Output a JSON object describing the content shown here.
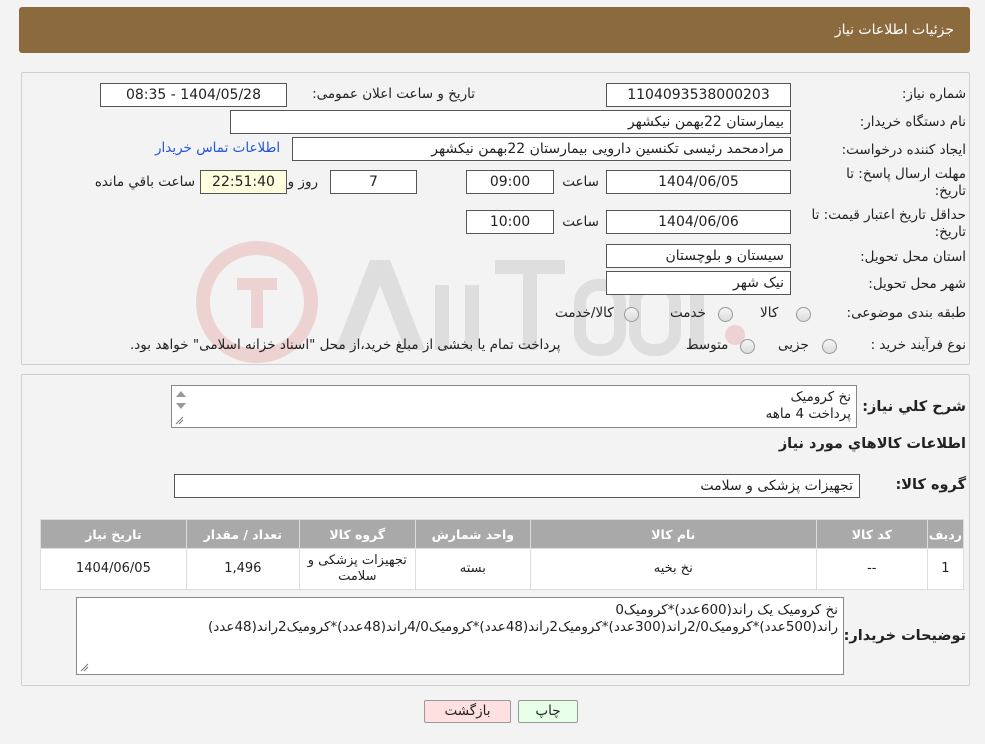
{
  "header": {
    "title": "جزئیات اطلاعات نیاز"
  },
  "form": {
    "need_number_label": "شماره نیاز:",
    "need_number": "1104093538000203",
    "announce_label": "تاریخ و ساعت اعلان عمومی:",
    "announce_value": "1404/05/28 - 08:35",
    "buyer_org_label": "نام دستگاه خریدار:",
    "buyer_org": "بیمارستان 22بهمن نیکشهر",
    "creator_label": "ایجاد کننده درخواست:",
    "creator": "مرادمحمد رئیسی تکنسین دارویی بیمارستان 22بهمن نیکشهر",
    "contact_link": "اطلاعات تماس خریدار",
    "deadline_label": "مهلت ارسال پاسخ: تا",
    "deadline_label2": "تاریخ:",
    "deadline_date": "1404/06/05",
    "time_label": "ساعت",
    "deadline_time": "09:00",
    "days_value": "7",
    "days_label": "روز و",
    "remaining_time": "22:51:40",
    "remaining_label": "ساعت باقي مانده",
    "validity_label": "حداقل تاریخ اعتبار قیمت: تا",
    "validity_label2": "تاریخ:",
    "validity_date": "1404/06/06",
    "validity_time": "10:00",
    "province_label": "استان محل تحویل:",
    "province": "سیستان و بلوچستان",
    "city_label": "شهر محل تحویل:",
    "city": "نیک شهر",
    "category_label": "طبقه بندی موضوعی:",
    "category_options": [
      "کالا",
      "خدمت",
      "کالا/خدمت"
    ],
    "process_label": "نوع فرآیند خرید :",
    "process_options": [
      "جزیی",
      "متوسط"
    ],
    "process_note": "پرداخت تمام یا بخشی از مبلغ خرید،از محل \"اسناد خزانه اسلامی\" خواهد بود."
  },
  "details": {
    "summary_label": "شرح کلي نياز:",
    "summary_line1": "نخ کرومیک",
    "summary_line2": "پرداخت 4 ماهه",
    "goods_info_title": "اطلاعات کالاهاي مورد نياز",
    "goods_group_label": "گروه کالا:",
    "goods_group": "تجهیزات پزشکی و سلامت",
    "table": {
      "headers": [
        "رديف",
        "کد کالا",
        "نام کالا",
        "واحد شمارش",
        "گروه کالا",
        "تعداد / مقدار",
        "تاريخ نياز"
      ],
      "rows": [
        [
          "1",
          "--",
          "نخ بخیه",
          "بسته",
          "تجهیزات پزشکی و سلامت",
          "1,496",
          "1404/06/05"
        ]
      ]
    },
    "buyer_notes_label": "توضیحات خریدار:",
    "buyer_notes_line1": "نخ کرومیک یک راند(600عدد)*کرومیک0",
    "buyer_notes_line2": "راند(500عدد)*کرومیک2/0راند(300عدد)*کرومیک2راند(48عدد)*کرومیک4/0راند(48عدد)*کرومیک2راند(48عدد)"
  },
  "buttons": {
    "print": "چاپ",
    "back": "بازگشت"
  },
  "colors": {
    "header": "#8b6a3e",
    "table_header": "#a9a9a9",
    "back_button": "#ffe0e0",
    "print_button": "#e6ffe6",
    "link": "#2255dd"
  }
}
